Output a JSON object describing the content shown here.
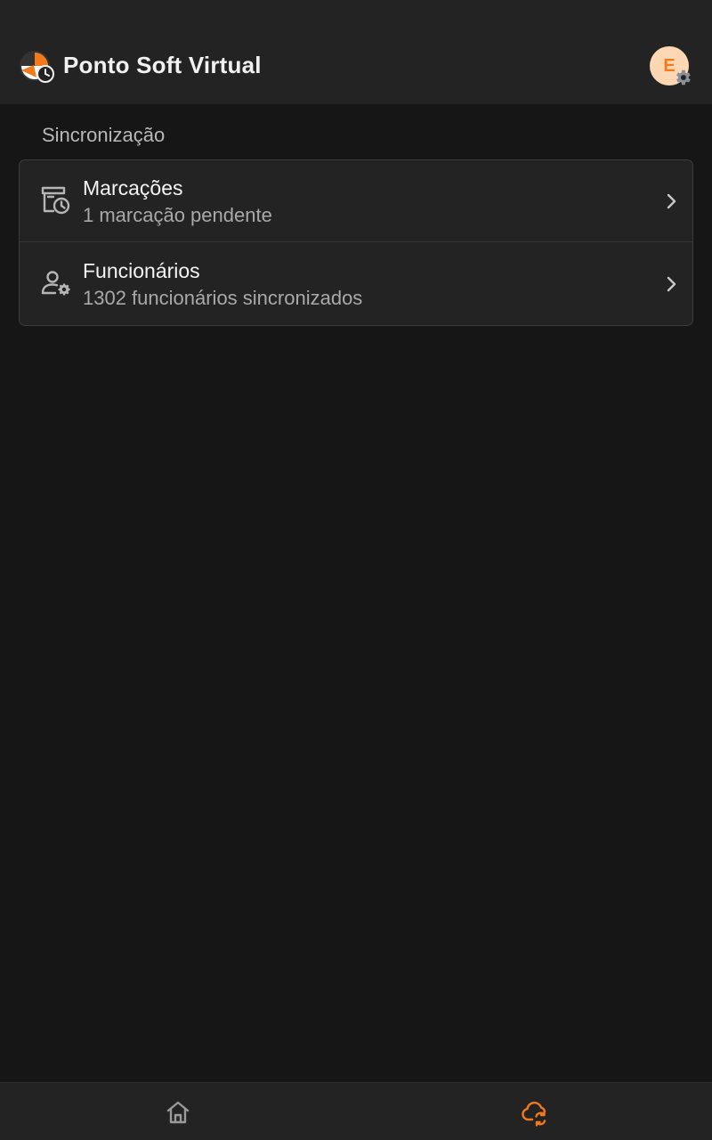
{
  "header": {
    "title": "Ponto Soft Virtual",
    "logo_icon": "ponto-soft-logo-icon",
    "avatar_initial": "E",
    "avatar_badge_icon": "gear-icon"
  },
  "section": {
    "title": "Sincronização",
    "items": [
      {
        "title": "Marcações",
        "subtitle": "1 marcação pendente",
        "icon": "time-records-icon"
      },
      {
        "title": "Funcionários",
        "subtitle": "1302 funcionários sincronizados",
        "icon": "user-settings-icon"
      }
    ]
  },
  "bottom_nav": {
    "items": [
      {
        "icon": "home-icon",
        "active": false
      },
      {
        "icon": "cloud-sync-icon",
        "active": true
      }
    ]
  },
  "colors": {
    "accent": "#f27a1a",
    "background": "#161616",
    "surface": "#232323",
    "avatar_bg": "#fdd7b3"
  }
}
